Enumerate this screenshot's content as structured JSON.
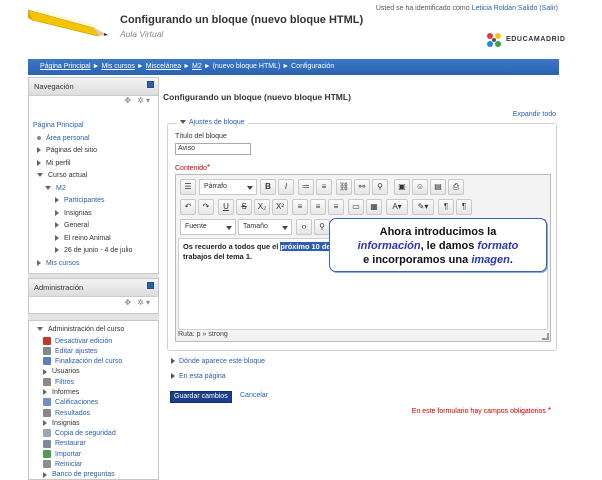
{
  "header": {
    "site_title": "Configurando un bloque (nuevo bloque HTML)",
    "site_subtitle": "Aula Virtual",
    "login_prefix": "Usted se ha identificado como",
    "user_name": "Leticia Roldán Salido",
    "logout": "(Salir)",
    "logo_text": "EDUCAMADRID"
  },
  "breadcrumb": {
    "items": [
      "Página Principal",
      "Mis cursos",
      "Miscelánea",
      "M2",
      "(nuevo bloque HTML)",
      "Configuración"
    ],
    "separator": "►"
  },
  "navigation_block": {
    "title": "Navegación",
    "items": [
      {
        "label": "Página Principal"
      },
      {
        "label": "Área personal"
      },
      {
        "label": "Páginas del sitio"
      },
      {
        "label": "Mi perfil"
      },
      {
        "label": "Curso actual"
      },
      {
        "label": "M2"
      },
      {
        "label": "Participantes"
      },
      {
        "label": "Insignias"
      },
      {
        "label": "General"
      },
      {
        "label": "El reino Animal"
      },
      {
        "label": "26 de junio - 4 de julio"
      },
      {
        "label": "Mis cursos"
      }
    ]
  },
  "accounts_block": {
    "title": "Administración"
  },
  "course_admin": {
    "title": "Administración del curso",
    "items": [
      {
        "label": "Desactivar edición",
        "icon": "edit-off-icon"
      },
      {
        "label": "Editar ajustes",
        "icon": "settings-icon"
      },
      {
        "label": "Finalización del curso",
        "icon": "completion-icon"
      },
      {
        "label": "Usuarios",
        "icon": "users-icon"
      },
      {
        "label": "Filtros",
        "icon": "filter-icon"
      },
      {
        "label": "Informes",
        "icon": "reports-icon"
      },
      {
        "label": "Calificaciones",
        "icon": "grades-icon"
      },
      {
        "label": "Resultados",
        "icon": "outcomes-icon"
      },
      {
        "label": "Insignias",
        "icon": "badges-icon"
      },
      {
        "label": "Copia de seguridad",
        "icon": "backup-icon"
      },
      {
        "label": "Restaurar",
        "icon": "restore-icon"
      },
      {
        "label": "Importar",
        "icon": "import-icon"
      },
      {
        "label": "Reiniciar",
        "icon": "reset-icon"
      },
      {
        "label": "Banco de preguntas",
        "icon": "question-bank-icon"
      }
    ]
  },
  "main": {
    "heading": "Configurando un bloque (nuevo bloque HTML)",
    "expand_all": "Expandir todo",
    "legend": "Ajustes de bloque",
    "title_label": "Título del bloque",
    "title_value": "Aviso",
    "content_label": "Contenido",
    "required_mark": "*",
    "toolbar": {
      "paragraph": "Párrafo",
      "font": "Fuente",
      "size": "Tamaño"
    },
    "content": {
      "part1": "Os recuerdo a todos que el ",
      "highlight": "próximo 10 de Octubre",
      "part2": " será la fecha límite para enviar vuestros trabajos del tema 1."
    },
    "path": "Ruta: p » strong",
    "callout": {
      "line1": "Ahora introducimos la",
      "em1": "información",
      "mid": ", le damos ",
      "em2": "formato",
      "line3a": "e incorporamos una ",
      "em3": "imagen",
      "end": "."
    },
    "section_where": "Dónde aparece este bloque",
    "section_page": "En esta página",
    "save": "Guardar cambios",
    "cancel": "Cancelar",
    "required_note": "En este formulario hay campos obligatorios"
  },
  "colors": {
    "navbar": "#2a62b0",
    "link": "#2a5db0",
    "highlight": "#2f5db3",
    "required": "#cc0000"
  }
}
